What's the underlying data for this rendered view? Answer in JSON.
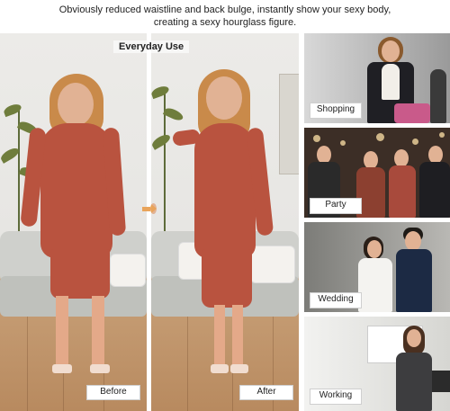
{
  "headline": {
    "line1": "Obviously reduced waistline and back bulge, instantly show your sexy body,",
    "line2": "creating a sexy hourglass figure."
  },
  "comparison": {
    "title": "Everyday Use",
    "before_label": "Before",
    "after_label": "After"
  },
  "occasions": [
    {
      "label": "Shopping"
    },
    {
      "label": "Party"
    },
    {
      "label": "Wedding"
    },
    {
      "label": "Working"
    }
  ],
  "colors": {
    "dress": "#b9533f",
    "arrow": "#e9a45b",
    "floor": "#b88a5f",
    "wall": "#ecebe8"
  },
  "icons": {
    "arrow": "right-arrow-icon"
  }
}
